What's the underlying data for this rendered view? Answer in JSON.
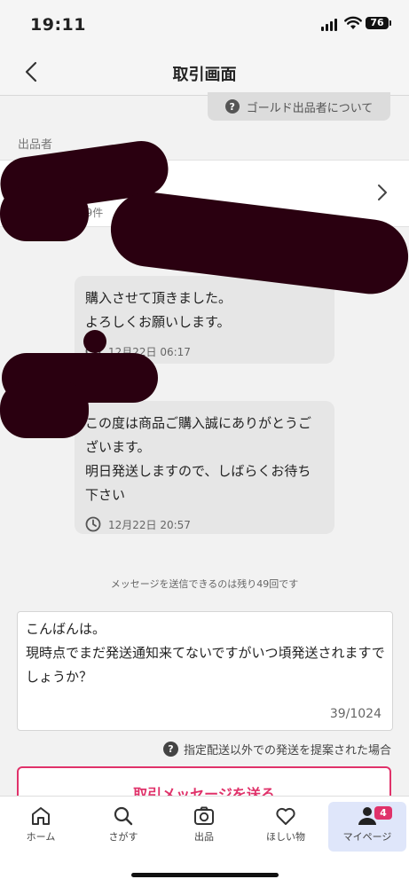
{
  "status_bar": {
    "time": "19:11",
    "battery": "76"
  },
  "header": {
    "title": "取引画面"
  },
  "gold_info": {
    "label": "ゴールド出品者について"
  },
  "seller": {
    "section_label": "出品者",
    "count": "29件"
  },
  "messages": [
    {
      "text": "購入させて頂きました。\nよろしくお願いします。",
      "time": "12月22日 06:17"
    },
    {
      "text": "この度は商品ご購入誠にありがとうございます。\n明日発送しますので、しばらくお待ち下さい",
      "time": "12月22日 20:57"
    }
  ],
  "remaining_notice": "メッセージを送信できるのは残り49回です",
  "compose": {
    "text": "こんばんは。\n現時点でまだ発送通知来てないですがいつ頃発送されますでしょうか？",
    "counter": "39/1024"
  },
  "help": {
    "label": "指定配送以外での発送を提案された場合"
  },
  "send_button": {
    "label": "取引メッセージを送る"
  },
  "tabs": [
    {
      "label": "ホーム",
      "icon": "home-icon"
    },
    {
      "label": "さがす",
      "icon": "search-icon"
    },
    {
      "label": "出品",
      "icon": "camera-icon"
    },
    {
      "label": "ほしい物",
      "icon": "heart-icon"
    },
    {
      "label": "マイページ",
      "icon": "person-icon",
      "badge": "4"
    }
  ],
  "colors": {
    "accent": "#e0326a",
    "active_tab_bg": "#dfe6fa",
    "redaction": "#2a0010"
  }
}
